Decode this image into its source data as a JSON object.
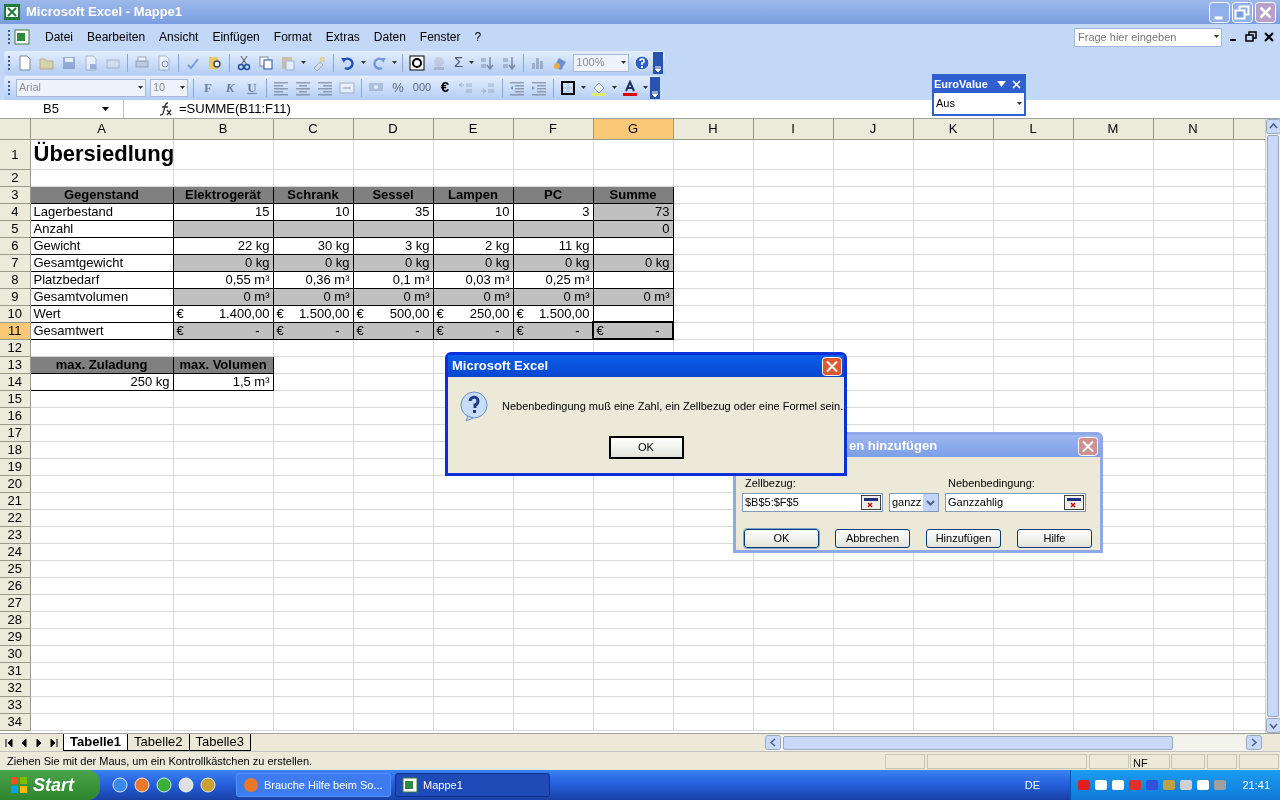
{
  "window": {
    "title": "Microsoft Excel - Mappe1"
  },
  "menu": [
    "Datei",
    "Bearbeiten",
    "Ansicht",
    "Einfügen",
    "Format",
    "Extras",
    "Daten",
    "Fenster",
    "?"
  ],
  "help_search": {
    "placeholder": "Frage hier eingeben"
  },
  "standard_toolbar": {
    "autosum": "Σ",
    "zoom": "100%"
  },
  "format_toolbar": {
    "font": "Arial",
    "size": "10",
    "bold": "F",
    "italic": "K",
    "underline": "U",
    "percent": "%",
    "thousands": "000",
    "euro": "€"
  },
  "eurovalue_toolbar": {
    "title": "EuroValue",
    "value": "Aus"
  },
  "formula_bar": {
    "name_box": "B5",
    "formula": "=SUMME(B11:F11)"
  },
  "sheet": {
    "columns": [
      {
        "label": "A",
        "selected": false
      },
      {
        "label": "B",
        "selected": false
      },
      {
        "label": "C",
        "selected": false
      },
      {
        "label": "D",
        "selected": false
      },
      {
        "label": "E",
        "selected": false
      },
      {
        "label": "F",
        "selected": false
      },
      {
        "label": "G",
        "selected": true
      },
      {
        "label": "H",
        "selected": false
      },
      {
        "label": "I",
        "selected": false
      },
      {
        "label": "J",
        "selected": false
      },
      {
        "label": "K",
        "selected": false
      },
      {
        "label": "L",
        "selected": false
      },
      {
        "label": "M",
        "selected": false
      },
      {
        "label": "N",
        "selected": false
      }
    ],
    "rows": [
      {
        "number": "1",
        "selected": false,
        "cells": [
          {
            "kind": "title",
            "text": "Übersiedlung"
          }
        ]
      },
      {
        "number": "2",
        "selected": false
      },
      {
        "number": "3",
        "selected": false,
        "cells": [
          {
            "kind": "header",
            "text": "Gegenstand"
          },
          {
            "kind": "header",
            "text": "Elektrogerät"
          },
          {
            "kind": "header",
            "text": "Schrank"
          },
          {
            "kind": "header",
            "text": "Sessel"
          },
          {
            "kind": "header",
            "text": "Lampen"
          },
          {
            "kind": "header",
            "text": "PC"
          },
          {
            "kind": "header",
            "text": "Summe"
          }
        ]
      },
      {
        "number": "4",
        "selected": false,
        "cells": [
          {
            "kind": "label",
            "text": "Lagerbestand",
            "shaded": false
          },
          {
            "kind": "value",
            "text": "15",
            "shaded": false
          },
          {
            "kind": "value",
            "text": "10",
            "shaded": false
          },
          {
            "kind": "value",
            "text": "35",
            "shaded": false
          },
          {
            "kind": "value",
            "text": "10",
            "shaded": false
          },
          {
            "kind": "value",
            "text": "3",
            "shaded": false
          },
          {
            "kind": "value",
            "text": "73",
            "shaded": true
          }
        ]
      },
      {
        "number": "5",
        "selected": false,
        "cells": [
          {
            "kind": "label",
            "text": "Anzahl",
            "shaded": false
          },
          {
            "kind": "blank",
            "shaded": true
          },
          {
            "kind": "blank",
            "shaded": true
          },
          {
            "kind": "blank",
            "shaded": true
          },
          {
            "kind": "blank",
            "shaded": true
          },
          {
            "kind": "blank",
            "shaded": true
          },
          {
            "kind": "value",
            "text": "0",
            "shaded": true
          }
        ]
      },
      {
        "number": "6",
        "selected": false,
        "cells": [
          {
            "kind": "label",
            "text": "Gewicht",
            "shaded": false
          },
          {
            "kind": "value",
            "text": "22 kg",
            "shaded": false
          },
          {
            "kind": "value",
            "text": "30 kg",
            "shaded": false
          },
          {
            "kind": "value",
            "text": "3 kg",
            "shaded": false
          },
          {
            "kind": "value",
            "text": "2 kg",
            "shaded": false
          },
          {
            "kind": "value",
            "text": "11 kg",
            "shaded": false
          },
          {
            "kind": "blank",
            "shaded": false
          }
        ]
      },
      {
        "number": "7",
        "selected": false,
        "cells": [
          {
            "kind": "label",
            "text": "Gesamtgewicht",
            "shaded": false
          },
          {
            "kind": "value",
            "text": "0 kg",
            "shaded": true
          },
          {
            "kind": "value",
            "text": "0 kg",
            "shaded": true
          },
          {
            "kind": "value",
            "text": "0 kg",
            "shaded": true
          },
          {
            "kind": "value",
            "text": "0 kg",
            "shaded": true
          },
          {
            "kind": "value",
            "text": "0 kg",
            "shaded": true
          },
          {
            "kind": "value",
            "text": "0 kg",
            "shaded": true
          }
        ]
      },
      {
        "number": "8",
        "selected": false,
        "cells": [
          {
            "kind": "label",
            "text": "Platzbedarf",
            "shaded": false
          },
          {
            "kind": "value",
            "text": "0,55 m³",
            "shaded": false
          },
          {
            "kind": "value",
            "text": "0,36 m³",
            "shaded": false
          },
          {
            "kind": "value",
            "text": "0,1 m³",
            "shaded": false
          },
          {
            "kind": "value",
            "text": "0,03 m³",
            "shaded": false
          },
          {
            "kind": "value",
            "text": "0,25 m³",
            "shaded": false
          },
          {
            "kind": "blank",
            "shaded": false
          }
        ]
      },
      {
        "number": "9",
        "selected": false,
        "cells": [
          {
            "kind": "label",
            "text": "Gesamtvolumen",
            "shaded": false
          },
          {
            "kind": "value",
            "text": "0 m³",
            "shaded": true
          },
          {
            "kind": "value",
            "text": "0 m³",
            "shaded": true
          },
          {
            "kind": "value",
            "text": "0 m³",
            "shaded": true
          },
          {
            "kind": "value",
            "text": "0 m³",
            "shaded": true
          },
          {
            "kind": "value",
            "text": "0 m³",
            "shaded": true
          },
          {
            "kind": "value",
            "text": "0 m³",
            "shaded": true
          }
        ]
      },
      {
        "number": "10",
        "selected": false,
        "cells": [
          {
            "kind": "label",
            "text": "Wert",
            "shaded": false
          },
          {
            "kind": "money",
            "symbol": "€",
            "amount": "1.400,00",
            "shaded": false
          },
          {
            "kind": "money",
            "symbol": "€",
            "amount": "1.500,00",
            "shaded": false
          },
          {
            "kind": "money",
            "symbol": "€",
            "amount": "500,00",
            "shaded": false
          },
          {
            "kind": "money",
            "symbol": "€",
            "amount": "250,00",
            "shaded": false
          },
          {
            "kind": "money",
            "symbol": "€",
            "amount": "1.500,00",
            "shaded": false
          },
          {
            "kind": "blank",
            "shaded": false
          }
        ]
      },
      {
        "number": "11",
        "selected": true,
        "cells": [
          {
            "kind": "label",
            "text": "Gesamtwert",
            "shaded": false
          },
          {
            "kind": "money",
            "symbol": "€",
            "amount": "-",
            "shaded": true
          },
          {
            "kind": "money",
            "symbol": "€",
            "amount": "-",
            "shaded": true
          },
          {
            "kind": "money",
            "symbol": "€",
            "amount": "-",
            "shaded": true
          },
          {
            "kind": "money",
            "symbol": "€",
            "amount": "-",
            "shaded": true
          },
          {
            "kind": "money",
            "symbol": "€",
            "amount": "-",
            "shaded": true
          },
          {
            "kind": "money",
            "symbol": "€",
            "amount": "-",
            "shaded": true
          }
        ]
      },
      {
        "number": "12",
        "selected": false
      },
      {
        "number": "13",
        "selected": false,
        "cells": [
          {
            "kind": "header",
            "text": "max. Zuladung"
          },
          {
            "kind": "header",
            "text": "max. Volumen"
          }
        ]
      },
      {
        "number": "14",
        "selected": false,
        "cells": [
          {
            "kind": "value",
            "text": "250 kg",
            "shaded": false
          },
          {
            "kind": "value",
            "text": "1,5 m³",
            "shaded": false
          }
        ]
      },
      {
        "number": "15",
        "selected": false
      },
      {
        "number": "16",
        "selected": false
      },
      {
        "number": "17",
        "selected": false
      },
      {
        "number": "18",
        "selected": false
      },
      {
        "number": "19",
        "selected": false
      },
      {
        "number": "20",
        "selected": false
      },
      {
        "number": "21",
        "selected": false
      },
      {
        "number": "22",
        "selected": false
      },
      {
        "number": "23",
        "selected": false
      },
      {
        "number": "24",
        "selected": false
      },
      {
        "number": "25",
        "selected": false
      },
      {
        "number": "26",
        "selected": false
      },
      {
        "number": "27",
        "selected": false
      },
      {
        "number": "28",
        "selected": false
      },
      {
        "number": "29",
        "selected": false
      },
      {
        "number": "30",
        "selected": false
      },
      {
        "number": "31",
        "selected": false
      },
      {
        "number": "32",
        "selected": false
      },
      {
        "number": "33",
        "selected": false
      },
      {
        "number": "34",
        "selected": false
      }
    ]
  },
  "sheet_tabs": [
    {
      "label": "Tabelle1",
      "selected": true
    },
    {
      "label": "Tabelle2",
      "selected": false
    },
    {
      "label": "Tabelle3",
      "selected": false
    }
  ],
  "status_bar": {
    "message": "Ziehen Sie mit der Maus, um ein Kontrollkästchen zu erstellen.",
    "indicator": "NF"
  },
  "message_box": {
    "title": "Microsoft Excel",
    "message": "Nebenbedingung muß eine Zahl, ein Zellbezug oder eine Formel sein.",
    "button": "OK"
  },
  "constraint_dialog": {
    "title": "en hinzufügen",
    "cell_ref_label": "Zellbezug:",
    "cell_ref": "$B$5:$F$5",
    "operator": "ganzz",
    "constraint_label": "Nebenbedingung:",
    "constraint": "Ganzzahlig",
    "buttons": [
      "OK",
      "Abbrechen",
      "Hinzufügen",
      "Hilfe"
    ]
  },
  "taskbar": {
    "start": "Start",
    "tasks": [
      {
        "label": "Brauche Hilfe beim So...",
        "selected": false
      },
      {
        "label": "Mappe1",
        "selected": true
      }
    ],
    "language": "DE",
    "clock": "21:41"
  }
}
